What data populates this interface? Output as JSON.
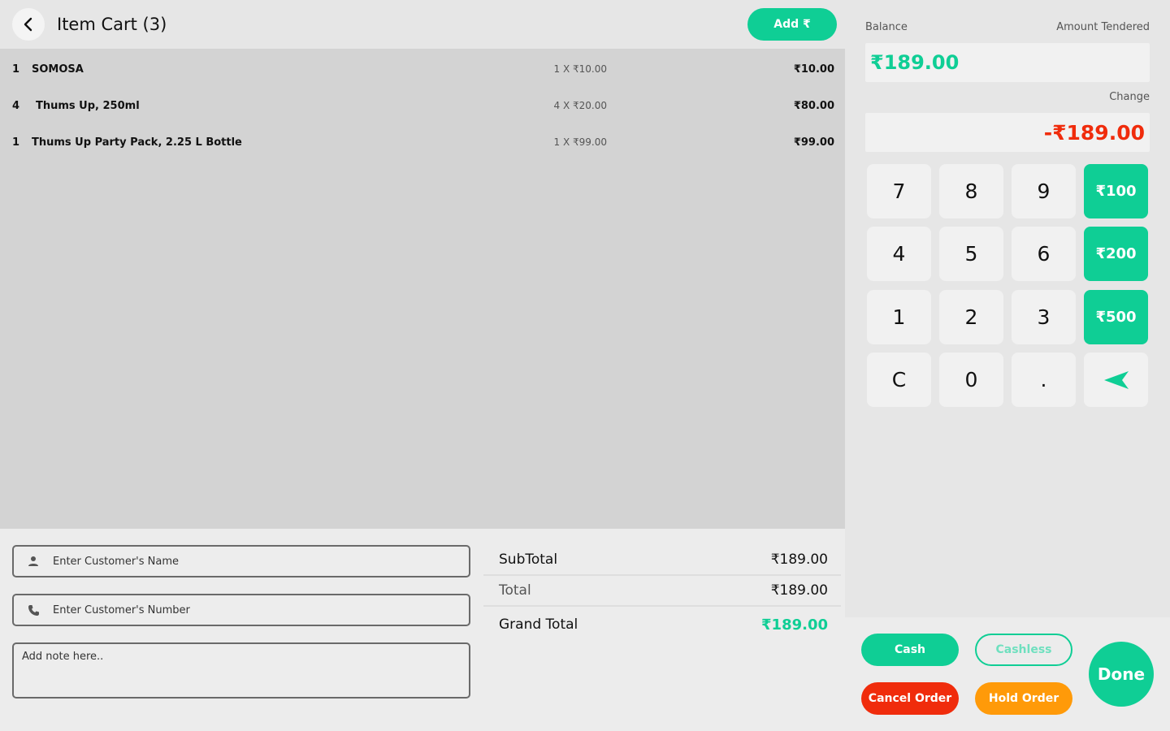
{
  "header": {
    "title": "Item Cart (3)",
    "add_label": "Add ₹"
  },
  "cart": {
    "items": [
      {
        "qty": "1",
        "name": "SOMOSA",
        "unit": "1 X ₹10.00",
        "total": "₹10.00"
      },
      {
        "qty": "4",
        "name": "Thums Up, 250ml",
        "unit": "4 X ₹20.00",
        "total": "₹80.00"
      },
      {
        "qty": "1",
        "name": "Thums Up Party Pack, 2.25 L Bottle",
        "unit": "1 X ₹99.00",
        "total": "₹99.00"
      }
    ]
  },
  "customer": {
    "name_placeholder": "Enter Customer's Name",
    "number_placeholder": "Enter Customer's Number",
    "note_placeholder": "Add note here.."
  },
  "summary": {
    "subtotal_label": "SubTotal",
    "subtotal": "₹189.00",
    "total_label": "Total",
    "total": "₹189.00",
    "grand_label": "Grand Total",
    "grand": "₹189.00"
  },
  "payment": {
    "balance_label": "Balance",
    "tendered_label": "Amount Tendered",
    "balance": "₹189.00",
    "change_label": "Change",
    "change": "-₹189.00"
  },
  "keypad": {
    "rows": [
      [
        "7",
        "8",
        "9",
        "₹100"
      ],
      [
        "4",
        "5",
        "6",
        "₹200"
      ],
      [
        "1",
        "2",
        "3",
        "₹500"
      ],
      [
        "C",
        "0",
        ".",
        "send-icon"
      ]
    ]
  },
  "actions": {
    "cash": "Cash",
    "cashless": "Cashless",
    "cancel": "Cancel Order",
    "hold": "Hold Order",
    "done": "Done"
  },
  "colors": {
    "accent": "#0fce95",
    "danger": "#f02c0c",
    "warning": "#ff9a09"
  }
}
